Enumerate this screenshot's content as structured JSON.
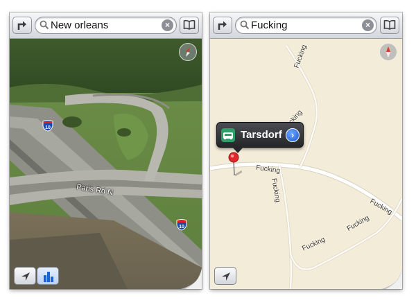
{
  "left_screen": {
    "search_query": "New orleans",
    "road_label": "Paris Rd N",
    "interstate_shield": "10",
    "mode": "3D satellite"
  },
  "right_screen": {
    "search_query": "Fucking",
    "callout_title": "Tarsdorf",
    "road_labels": [
      "Fucking",
      "Fucking",
      "Fucking",
      "Fucking",
      "Fucking",
      "Fucking",
      "Fucking"
    ]
  },
  "colors": {
    "map_background": "#f3ecd8",
    "road": "#ffffff",
    "pin": "#e0272b",
    "callout_accent": "#2e9f69",
    "disclosure": "#1d5bd6"
  },
  "icons": [
    "directions-icon",
    "search-icon",
    "clear-icon",
    "bookmarks-icon",
    "compass-icon",
    "location-arrow-icon",
    "3d-buildings-icon",
    "page-curl-icon",
    "car-icon",
    "disclosure-icon",
    "map-pin-icon"
  ]
}
